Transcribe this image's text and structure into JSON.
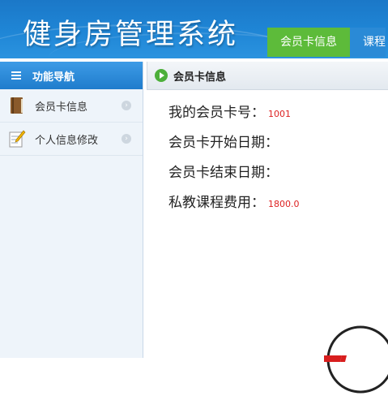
{
  "header": {
    "app_title": "健身房管理系统",
    "tabs": [
      {
        "label": "会员卡信息",
        "active": true
      },
      {
        "label": "课程",
        "active": false
      }
    ]
  },
  "sidebar": {
    "title": "功能导航",
    "items": [
      {
        "label": "会员卡信息",
        "icon": "book-icon"
      },
      {
        "label": "个人信息修改",
        "icon": "notepad-pencil-icon"
      }
    ]
  },
  "content": {
    "title": "会员卡信息",
    "fields": [
      {
        "label": "我的会员卡号：",
        "value": "1001"
      },
      {
        "label": "会员卡开始日期：",
        "value": ""
      },
      {
        "label": "会员卡结束日期：",
        "value": ""
      },
      {
        "label": "私教课程费用：",
        "value": "1800.0"
      }
    ]
  },
  "colors": {
    "header_blue": "#1f86d6",
    "active_tab_green": "#5dbb3a",
    "value_red": "#dd2222"
  }
}
